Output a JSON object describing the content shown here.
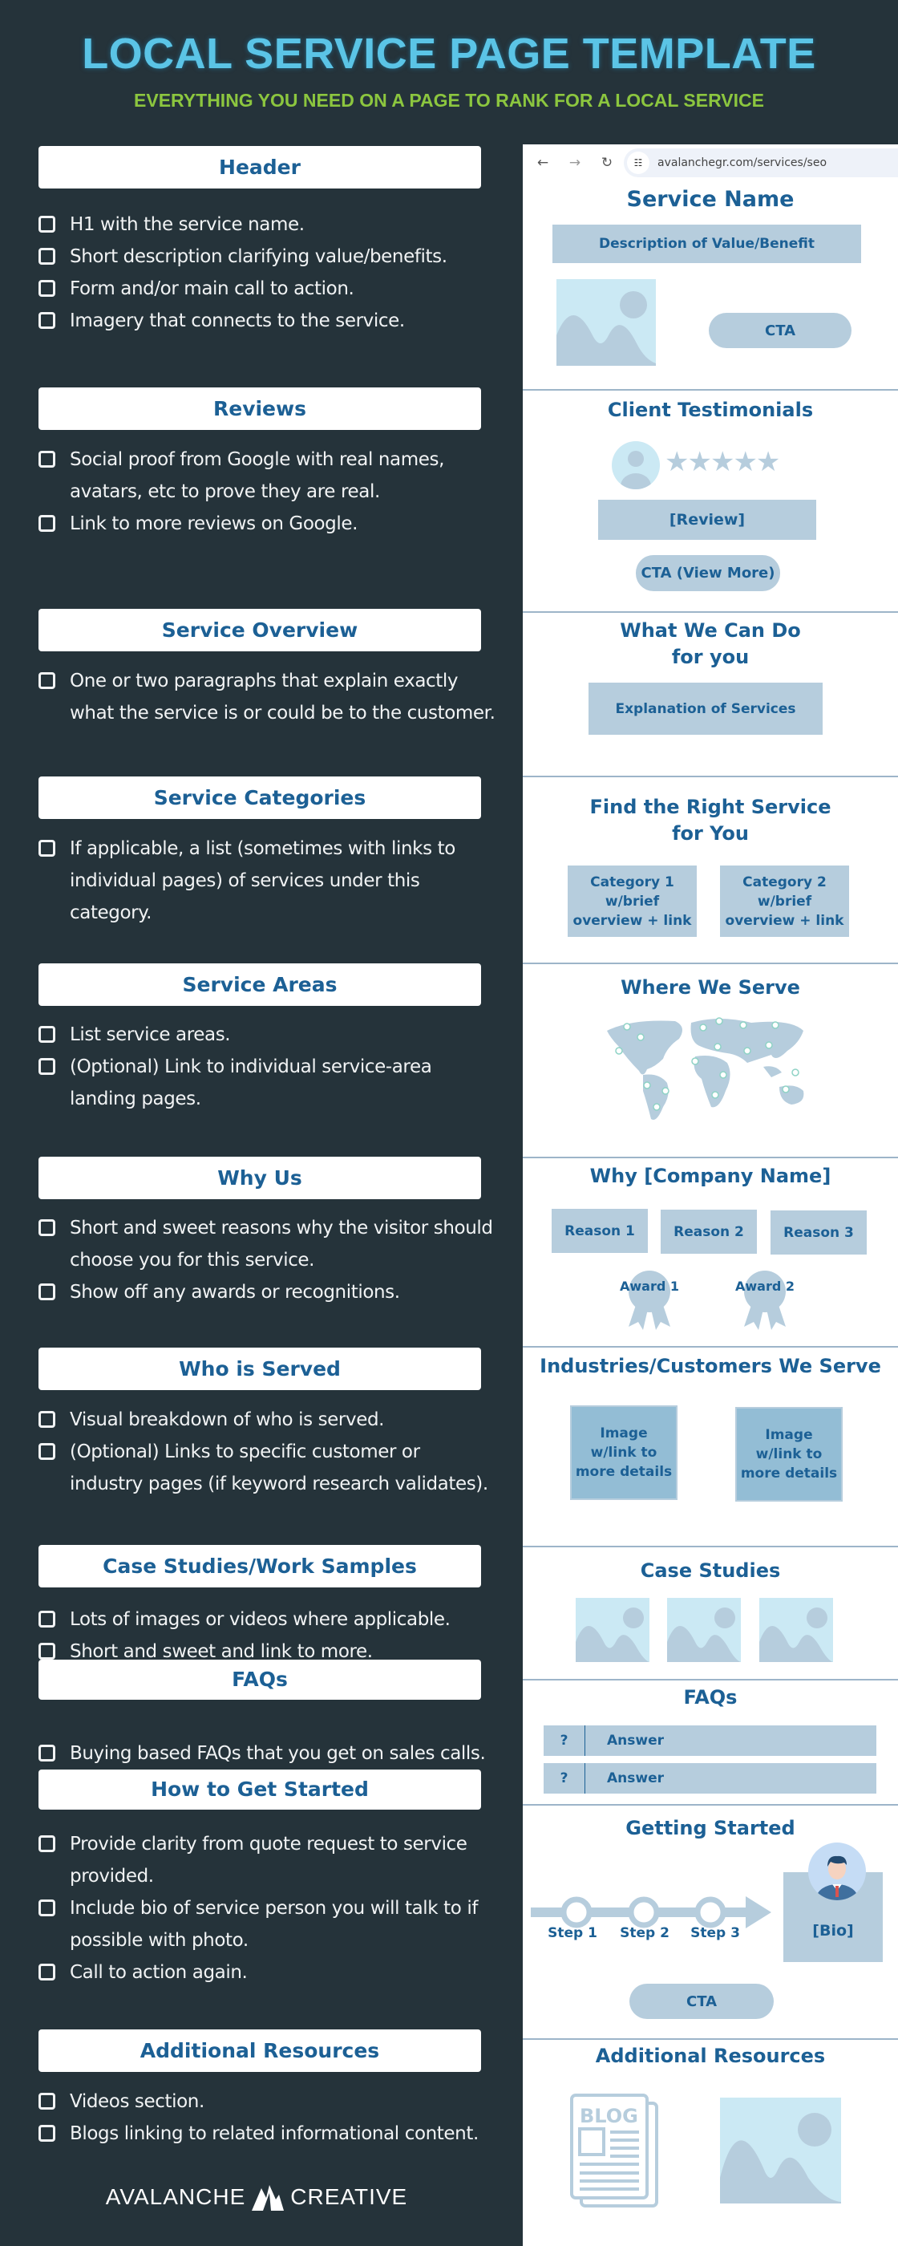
{
  "header": {
    "title": "LOCAL SERVICE PAGE TEMPLATE",
    "subtitle": "EVERYTHING YOU NEED ON A PAGE TO RANK FOR A LOCAL SERVICE"
  },
  "colors": {
    "background": "#25333a",
    "title": "#5bc4e6",
    "subtitle": "#8cc63f",
    "heading": "#1c6095",
    "placeholder_fill": "#b6cddd",
    "image_bg": "#cbe9f4"
  },
  "sections": [
    {
      "title": "Header",
      "items": [
        "H1 with the service name.",
        "Short description clarifying value/benefits.",
        "Form and/or main call to action.",
        "Imagery that connects to the service."
      ]
    },
    {
      "title": "Reviews",
      "items": [
        "Social proof from Google with real names, avatars, etc to prove they are real.",
        "Link to more reviews on Google."
      ]
    },
    {
      "title": "Service Overview",
      "items": [
        "One or two paragraphs that explain exactly what the service is or could be to the customer."
      ]
    },
    {
      "title": "Service Categories",
      "items": [
        "If applicable, a list (sometimes with links to individual pages) of services under this category."
      ]
    },
    {
      "title": "Service Areas",
      "items": [
        "List service areas.",
        "(Optional) Link to individual service-area landing pages."
      ]
    },
    {
      "title": "Why Us",
      "items": [
        "Short and sweet reasons why the visitor should choose you for this service.",
        "Show off any awards or recognitions."
      ]
    },
    {
      "title": "Who is Served",
      "items": [
        "Visual breakdown of who is served.",
        "(Optional) Links to specific customer or industry pages (if keyword research validates)."
      ]
    },
    {
      "title": "Case Studies/Work Samples",
      "items": [
        "Lots of images or videos where applicable.",
        "Short and sweet and link to more."
      ]
    },
    {
      "title": "FAQs",
      "items": [
        "Buying based FAQs that you get on sales calls."
      ]
    },
    {
      "title": "How to Get Started",
      "items": [
        "Provide clarity from quote request to service provided.",
        "Include bio of service person you will talk to if possible with photo.",
        "Call to action again."
      ]
    },
    {
      "title": "Additional Resources",
      "items": [
        "Videos section.",
        "Blogs linking to related informational content."
      ]
    }
  ],
  "mockup": {
    "browser": {
      "url": "avalanchegr.com/services/seo",
      "back": "←",
      "forward": "→",
      "reload": "↻"
    },
    "hero": {
      "title": "Service Name",
      "description": "Description of Value/Benefit",
      "cta": "CTA"
    },
    "testimonials": {
      "title": "Client Testimonials",
      "rating": 5,
      "review": "[Review]",
      "cta": "CTA (View More)"
    },
    "overview": {
      "title_line1": "What We Can Do",
      "title_line2": "for you",
      "box": "Explanation of Services"
    },
    "categories": {
      "title_line1": "Find the Right Service",
      "title_line2": "for You",
      "cards": [
        "Category 1 w/brief overview + link",
        "Category 2 w/brief overview + link"
      ]
    },
    "areas": {
      "title": "Where We Serve"
    },
    "why": {
      "title": "Why [Company Name]",
      "reasons": [
        "Reason 1",
        "Reason 2",
        "Reason 3"
      ],
      "awards": [
        "Award 1",
        "Award 2"
      ]
    },
    "industries": {
      "title": "Industries/Customers We Serve",
      "cards": [
        "Image w/link to more details",
        "Image w/link to more details"
      ]
    },
    "case_studies": {
      "title": "Case Studies"
    },
    "faqs": {
      "title": "FAQs",
      "rows": [
        {
          "q": "?",
          "a": "Answer"
        },
        {
          "q": "?",
          "a": "Answer"
        }
      ]
    },
    "getting_started": {
      "title": "Getting Started",
      "steps": [
        "Step 1",
        "Step 2",
        "Step 3"
      ],
      "bio": "[Bio]",
      "cta": "CTA"
    },
    "resources": {
      "title": "Additional Resources",
      "blog_label": "BLOG"
    }
  },
  "footer": {
    "brand_left": "AVALANCHE",
    "brand_right": "CREATIVE"
  }
}
